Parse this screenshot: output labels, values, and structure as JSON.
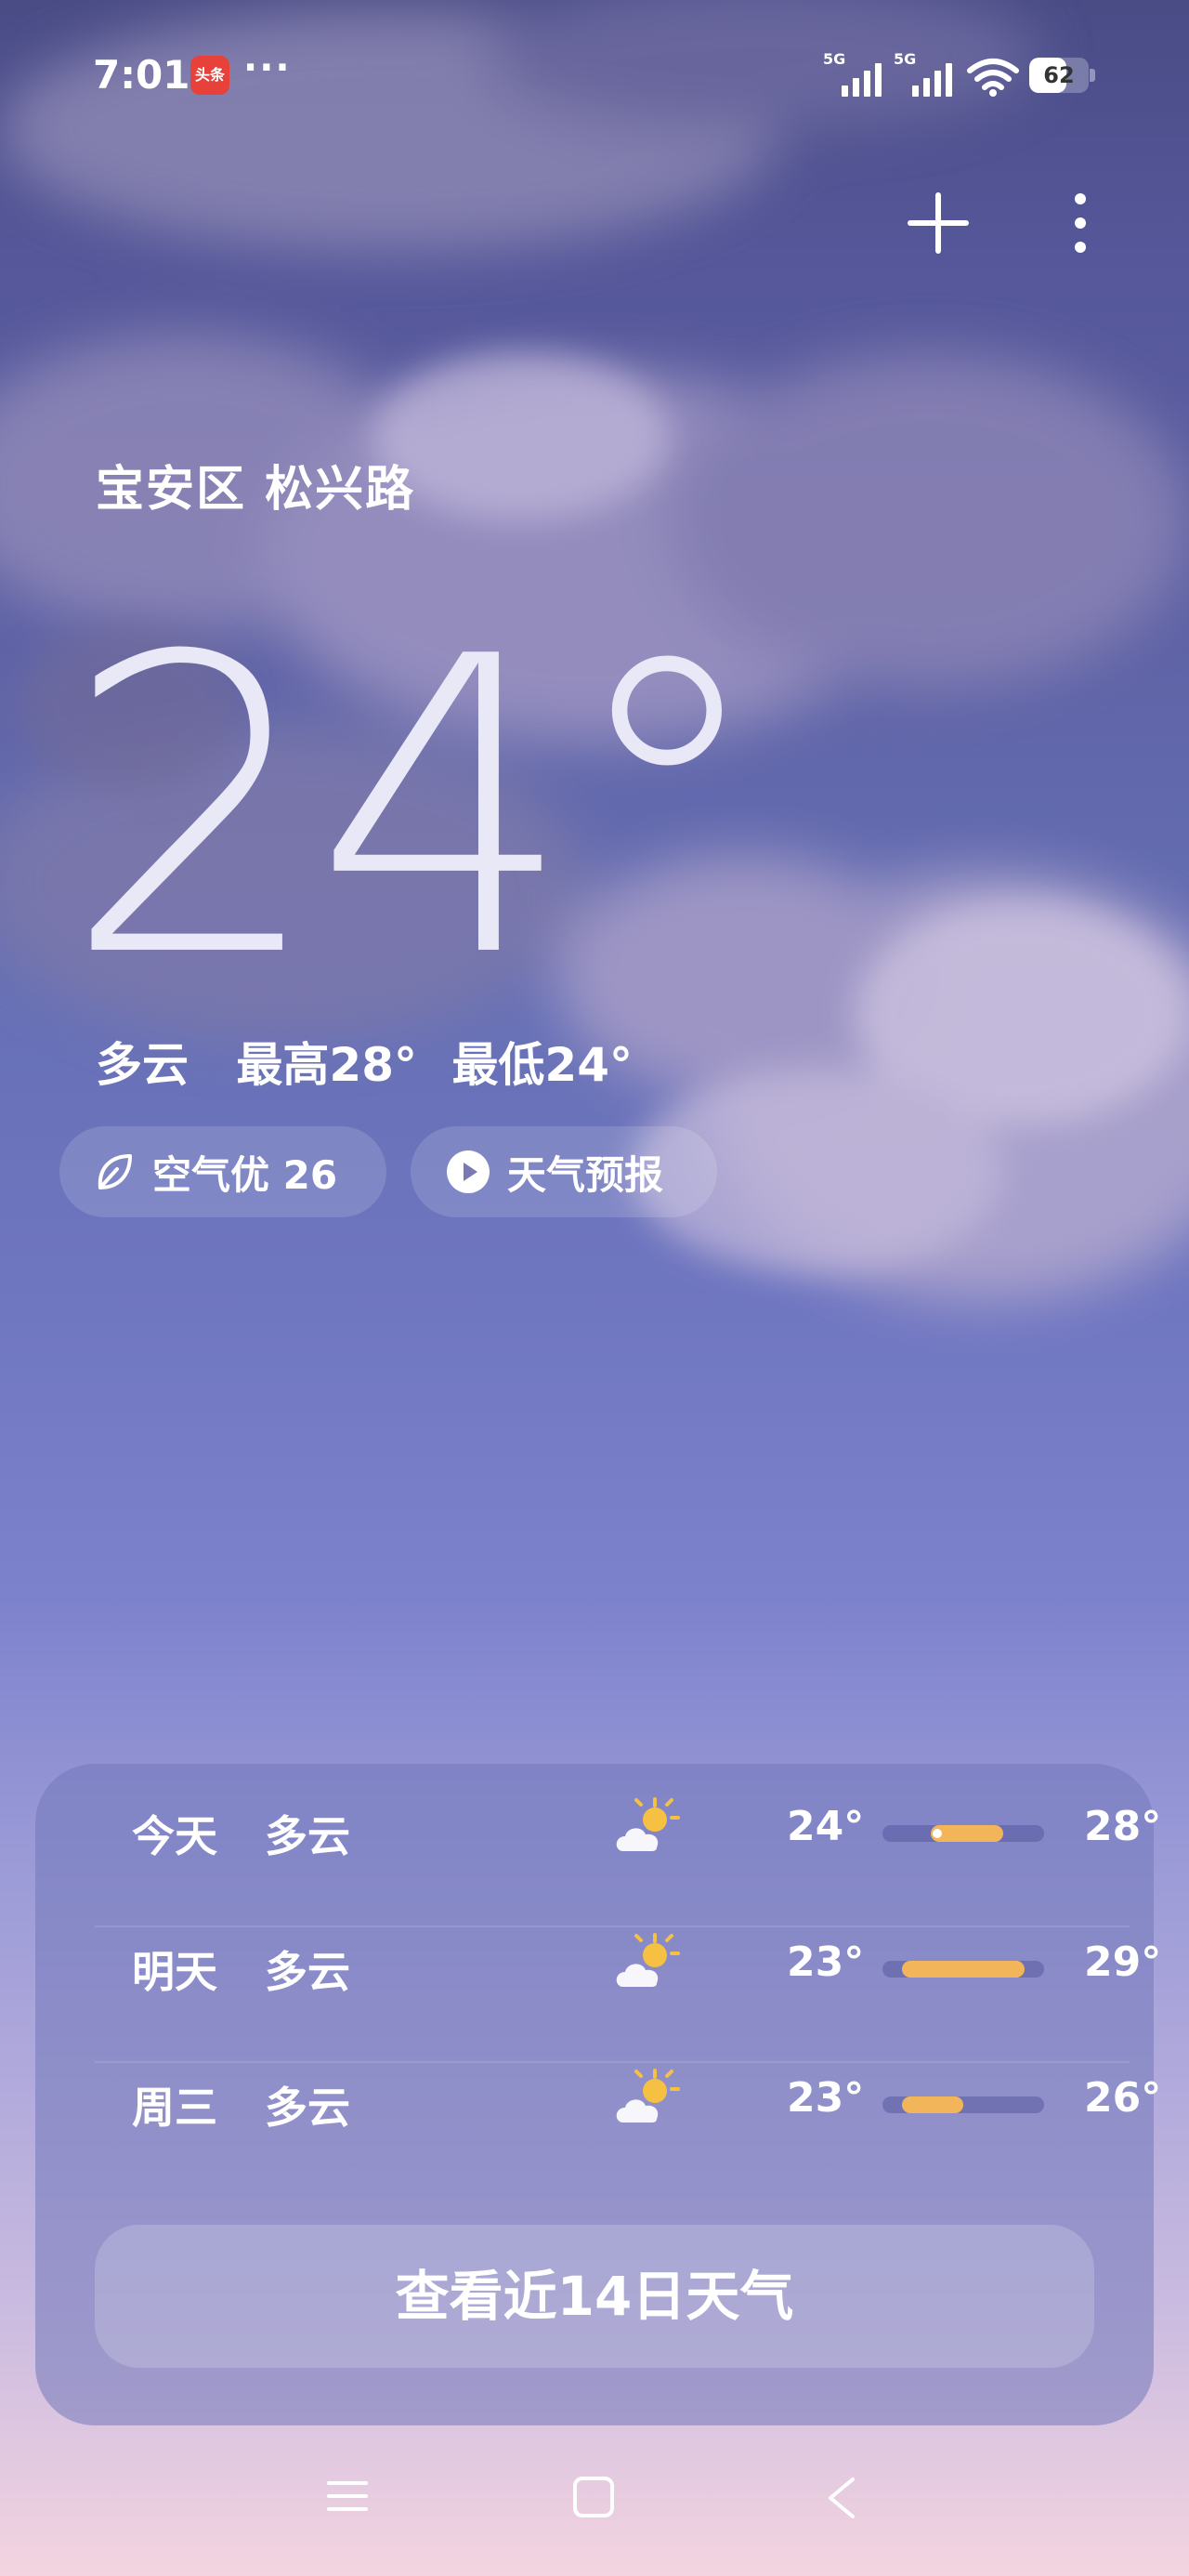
{
  "status_bar": {
    "time": "7:01",
    "app_badge": "头条",
    "more": "···",
    "signal1_label": "5G",
    "signal2_label": "5G",
    "battery_level": 62,
    "battery_text": "62"
  },
  "header": {
    "add_icon": "plus-icon",
    "menu_icon": "more-vertical-icon"
  },
  "location": "宝安区 松兴路",
  "current": {
    "temperature": "24°",
    "condition": "多云",
    "high": "最高28°",
    "low": "最低24°"
  },
  "pills": {
    "air_quality": "空气优 26",
    "forecast": "天气预报"
  },
  "forecast": {
    "rows": [
      {
        "day": "今天",
        "condition": "多云",
        "icon": "partly-cloudy-icon",
        "low": "24°",
        "high": "28°",
        "range": [
          0.3,
          0.75
        ],
        "current_marker": 0.31
      },
      {
        "day": "明天",
        "condition": "多云",
        "icon": "partly-cloudy-icon",
        "low": "23°",
        "high": "29°",
        "range": [
          0.12,
          0.88
        ]
      },
      {
        "day": "周三",
        "condition": "多云",
        "icon": "partly-cloudy-icon",
        "low": "23°",
        "high": "26°",
        "range": [
          0.12,
          0.5
        ]
      }
    ],
    "cta": "查看近14日天气"
  },
  "colors": {
    "range_bar": "#f3b55a",
    "app_badge": "#e8413a"
  }
}
